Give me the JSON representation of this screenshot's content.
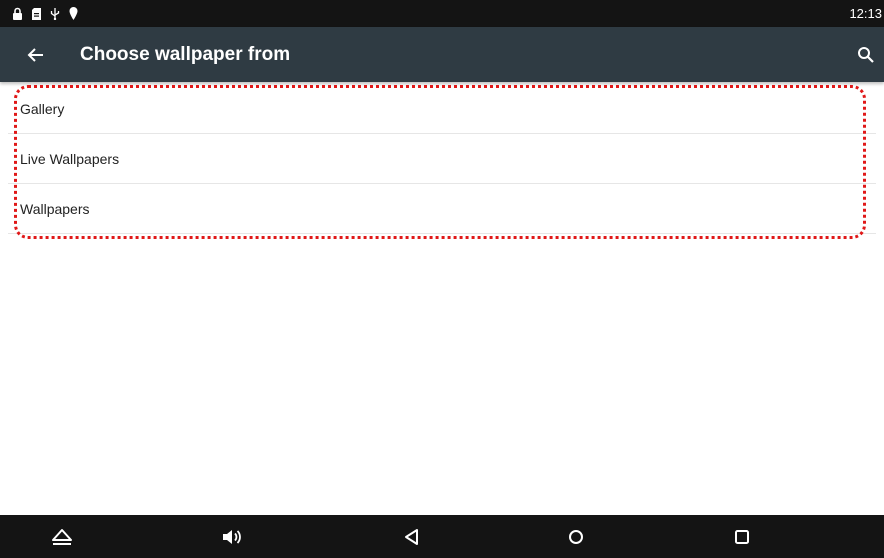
{
  "status_bar": {
    "time": "12:13",
    "icons": [
      "lock-icon",
      "sd-card-icon",
      "usb-icon",
      "location-pin-icon"
    ]
  },
  "app_bar": {
    "title": "Choose wallpaper from",
    "back_icon": "arrow-left-icon",
    "search_icon": "search-icon"
  },
  "list": {
    "items": [
      {
        "label": "Gallery"
      },
      {
        "label": "Live Wallpapers"
      },
      {
        "label": "Wallpapers"
      }
    ]
  },
  "annotation": {
    "color": "#e01818"
  },
  "nav_bar": {
    "buttons": [
      "eject-icon",
      "volume-icon",
      "back-triangle-icon",
      "home-circle-icon",
      "recents-square-icon"
    ]
  }
}
